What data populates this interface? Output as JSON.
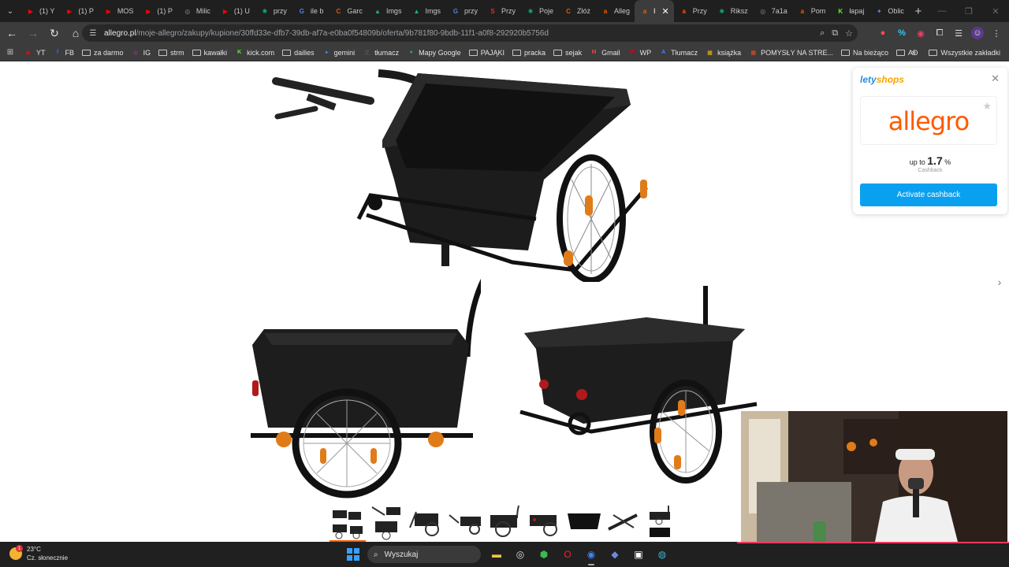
{
  "browser": {
    "tabs": [
      {
        "title": "(1) Y",
        "fav": "youtube",
        "color": "#ff0000"
      },
      {
        "title": "(1) P",
        "fav": "youtube",
        "color": "#ff0000"
      },
      {
        "title": "MOS",
        "fav": "youtube",
        "color": "#ff0000"
      },
      {
        "title": "(1) P",
        "fav": "youtube",
        "color": "#ff0000"
      },
      {
        "title": "Milic",
        "fav": "globe",
        "color": "#8a8a8a"
      },
      {
        "title": "(1) U",
        "fav": "youtube",
        "color": "#ff0000"
      },
      {
        "title": "przy",
        "fav": "chatgpt",
        "color": "#10a37f"
      },
      {
        "title": "ile b",
        "fav": "google",
        "color": "#4285f4"
      },
      {
        "title": "Garc",
        "fav": "c",
        "color": "#e8590c"
      },
      {
        "title": "Imgs",
        "fav": "img",
        "color": "#1fb57a"
      },
      {
        "title": "Imgs",
        "fav": "img",
        "color": "#1fb57a"
      },
      {
        "title": "przy",
        "fav": "google",
        "color": "#4285f4"
      },
      {
        "title": "Przy",
        "fav": "s",
        "color": "#d93025"
      },
      {
        "title": "Poje",
        "fav": "chatgpt",
        "color": "#10a37f"
      },
      {
        "title": "Złóż",
        "fav": "c",
        "color": "#e8590c"
      },
      {
        "title": "Alleg",
        "fav": "allegro",
        "color": "#ff5a00"
      },
      {
        "title": "I",
        "fav": "allegro",
        "color": "#ff5a00",
        "active": true
      },
      {
        "title": "Przy",
        "fav": "allegro",
        "color": "#ff5a00"
      },
      {
        "title": "Riksz",
        "fav": "chatgpt",
        "color": "#10a37f"
      },
      {
        "title": "7a1a",
        "fav": "globe",
        "color": "#8a8a8a"
      },
      {
        "title": "Pom",
        "fav": "allegro",
        "color": "#ff5a00"
      },
      {
        "title": "łapaj",
        "fav": "k",
        "color": "#53fc18"
      },
      {
        "title": "Oblic",
        "fav": "gemini",
        "color": "#4f8bf9"
      }
    ],
    "new_tab": "+",
    "url_domain": "allegro.pl",
    "url_path": "/moje-allegro/zakupy/kupione/30ffd33e-dfb7-39db-af7a-e0ba0f54809b/oferta/9b781f80-9bdb-11f1-a0f8-292920b5756d"
  },
  "bookmarks": [
    {
      "label": "YT",
      "icon": "youtube",
      "color": "#ff0000"
    },
    {
      "label": "FB",
      "icon": "facebook",
      "color": "#1877f2"
    },
    {
      "label": "za darmo",
      "icon": "folder"
    },
    {
      "label": "IG",
      "icon": "instagram",
      "color": "#d6249f"
    },
    {
      "label": "strm",
      "icon": "folder"
    },
    {
      "label": "kawałki",
      "icon": "folder"
    },
    {
      "label": "kick.com",
      "icon": "kick",
      "color": "#53fc18"
    },
    {
      "label": "dailies",
      "icon": "folder"
    },
    {
      "label": "gemini",
      "icon": "gemini",
      "color": "#4f8bf9"
    },
    {
      "label": "tłumacz",
      "icon": "translate",
      "color": "#555555"
    },
    {
      "label": "Mapy Google",
      "icon": "maps",
      "color": "#34a853"
    },
    {
      "label": "PAJĄKI",
      "icon": "folder"
    },
    {
      "label": "pracka",
      "icon": "folder"
    },
    {
      "label": "sejak",
      "icon": "folder"
    },
    {
      "label": "Gmail",
      "icon": "gmail",
      "color": "#ea4335"
    },
    {
      "label": "WP",
      "icon": "wp",
      "color": "#d0021b"
    },
    {
      "label": "Tłumacz",
      "icon": "translate2",
      "color": "#4285f4"
    },
    {
      "label": "książka",
      "icon": "book",
      "color": "#fbbc05"
    },
    {
      "label": "POMYSŁY NA STRE...",
      "icon": "ms",
      "color": "#f25022"
    },
    {
      "label": "Na bieżąco",
      "icon": "folder"
    },
    {
      "label": "AD",
      "icon": "folder"
    }
  ],
  "bookmarks_more": "»",
  "bookmarks_all": "Wszystkie zakładki",
  "lety": {
    "brand_a": "lety",
    "brand_b": "shops",
    "shop": "allegro",
    "cashback_prefix": "up to",
    "cashback_value": "1.7",
    "cashback_unit": "%",
    "cashback_label": "Cashback",
    "button": "Activate cashback"
  },
  "taskbar": {
    "temp": "23°C",
    "weather": "Cz. słonecznie",
    "badge": "1",
    "search_placeholder": "Wyszukaj"
  }
}
